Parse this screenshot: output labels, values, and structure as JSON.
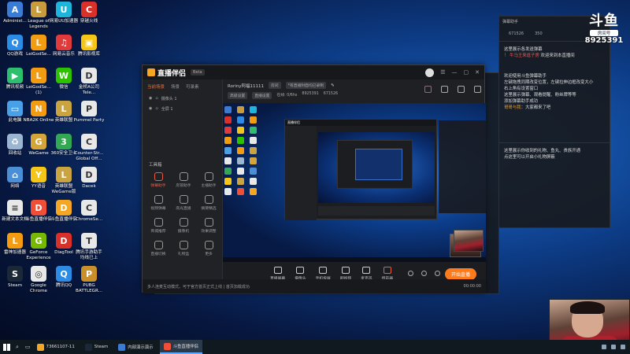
{
  "desktop": {
    "icons": [
      {
        "label": "Administ...",
        "color": "#3a7bd5",
        "glyph": "A"
      },
      {
        "label": "League of Legends",
        "color": "#c89b3c",
        "glyph": "L"
      },
      {
        "label": "网易UU加速器",
        "color": "#1db5d9",
        "glyph": "U"
      },
      {
        "label": "穿越火线",
        "color": "#d9302a",
        "glyph": "C"
      },
      {
        "label": "QQ游戏",
        "color": "#2b8be5",
        "glyph": "Q"
      },
      {
        "label": "LeiGodSe...",
        "color": "#f39c12",
        "glyph": "L"
      },
      {
        "label": "网易云音乐",
        "color": "#e03a3a",
        "glyph": "♫"
      },
      {
        "label": "腾讯影视库",
        "color": "#f5c518",
        "glyph": "▣"
      },
      {
        "label": "腾讯视频",
        "color": "#2dbf6e",
        "glyph": "▶"
      },
      {
        "label": "LeiGodSe... (1)",
        "color": "#f39c12",
        "glyph": "L"
      },
      {
        "label": "微信",
        "color": "#2dc100",
        "glyph": "W"
      },
      {
        "label": "金桥A公司 Tele...",
        "color": "#e8e8e8",
        "glyph": "D"
      },
      {
        "label": "此电脑",
        "color": "#4aa0e6",
        "glyph": "▭"
      },
      {
        "label": "NBA2K Online",
        "color": "#f39c12",
        "glyph": "N"
      },
      {
        "label": "英雄联盟",
        "color": "#c9a441",
        "glyph": "L"
      },
      {
        "label": "Pummel Party",
        "color": "#e8e8e8",
        "glyph": "P"
      },
      {
        "label": "回收站",
        "color": "#9ab6d1",
        "glyph": "♻"
      },
      {
        "label": "WeGame",
        "color": "#d4a63a",
        "glyph": "G"
      },
      {
        "label": "360安全卫士",
        "color": "#33a852",
        "glyph": "3"
      },
      {
        "label": "Counter-Str... Global Off...",
        "color": "#e8e8e8",
        "glyph": "C"
      },
      {
        "label": "网络",
        "color": "#4a8fd6",
        "glyph": "⌂"
      },
      {
        "label": "YY语音",
        "color": "#f5c518",
        "glyph": "Y"
      },
      {
        "label": "英雄联盟 WeGame版",
        "color": "#c9a441",
        "glyph": "L"
      },
      {
        "label": "Dacek",
        "color": "#e8e8e8",
        "glyph": "D"
      },
      {
        "label": "新建文本文档",
        "color": "#e8e8e8",
        "glyph": "≡"
      },
      {
        "label": "斗鱼直播伴侣",
        "color": "#f04e37",
        "glyph": "D"
      },
      {
        "label": "斗鱼直播伴侣",
        "color": "#f5a623",
        "glyph": "D"
      },
      {
        "label": "ChromeSe...",
        "color": "#e8e8e8",
        "glyph": "C"
      },
      {
        "label": "雷神加速器",
        "color": "#f39c12",
        "glyph": "L"
      },
      {
        "label": "GeForce Experience",
        "color": "#76b900",
        "glyph": "G"
      },
      {
        "label": "DiagTool",
        "color": "#d9302a",
        "glyph": "D"
      },
      {
        "label": "腾讯手游助手 均线已上",
        "color": "#e8e8e8",
        "glyph": "T"
      },
      {
        "label": "Steam",
        "color": "#1b2838",
        "glyph": "S"
      },
      {
        "label": "Google Chrome",
        "color": "#e8e8e8",
        "glyph": "◎"
      },
      {
        "label": "腾讯QQ",
        "color": "#2b8be5",
        "glyph": "Q"
      },
      {
        "label": "PUBG BATTLEGR...",
        "color": "#c98f2a",
        "glyph": "P"
      }
    ]
  },
  "logo": {
    "big": "斗鱼",
    "sub": "房间号",
    "room": "8925391"
  },
  "chat": {
    "title": "弹幕助手",
    "stat1": "671526",
    "stat2": "350",
    "lines": [
      {
        "text": "这里展示各发送弹幕",
        "cls": ""
      },
      {
        "prefix": "！ 牛马王来逛子房",
        "text": " 欢迎来到本直播间",
        "cls": "hl2"
      },
      {
        "text": "欢迎使用斗鱼弹幕助手",
        "cls": ""
      },
      {
        "text": "左键拖拽同期改变位置，左键拉伸边框改变大小",
        "cls": ""
      },
      {
        "text": "右上角有设置窗口",
        "cls": ""
      },
      {
        "text": "这里展示弹幕、观看提醒、粉丝牌等等",
        "cls": ""
      },
      {
        "text": "添加弹幕助手成功",
        "cls": ""
      },
      {
        "prefix": "哥哥与我",
        "text": "：大家都来了吧",
        "cls": "hl"
      }
    ],
    "gift_lines": [
      "这里展示你收到的礼物、鱼丸、贵族开通",
      "点这里可以开启小礼物屏蔽"
    ]
  },
  "app": {
    "name": "直播伴侣",
    "version": "Beta",
    "side_tabs": [
      "当前场景",
      "场景",
      "可录素"
    ],
    "scenes": [
      "摄像头 1",
      "全屏 1"
    ],
    "tools_label": "工具箱",
    "tools": [
      "弹幕助手",
      "房管助手",
      "主播助手",
      "视频弹幕",
      "高光直播",
      "摘要精选",
      "商城推荐",
      "摄像机",
      "效果调整",
      "直播切换",
      "礼物盒",
      "更多"
    ],
    "room_title": "Roriny阿福11111",
    "room_chip": "房间",
    "room_notice": "*有直播封面均已录制",
    "room_line2": [
      "高级设置",
      "直播设置",
      "在线: 0/6hs",
      "8925391",
      "671526"
    ],
    "bottom": [
      "直播屏幕",
      "摄像头",
      "手机投屏",
      "刷视频",
      "麦克风",
      "扬声器"
    ],
    "go_live": "开始直播",
    "status_text": "多人连麦互动模式，可于官方首页正式上线 | 首页加载成功",
    "status_time": "00:00:00"
  },
  "taskbar": {
    "items": [
      {
        "label": "73661107-11",
        "color": "#f5a623",
        "active": false
      },
      {
        "label": "Steam",
        "color": "#1b2838",
        "active": false
      },
      {
        "label": "内部演示演示",
        "color": "#3a7bd5",
        "active": false
      },
      {
        "label": "斗鱼直播伴侣",
        "color": "#f04e37",
        "active": true
      }
    ]
  }
}
